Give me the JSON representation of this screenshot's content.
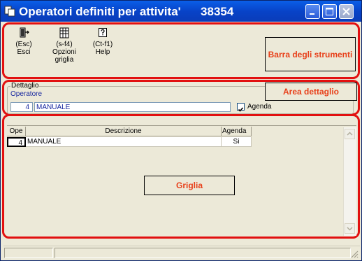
{
  "window": {
    "title": "Operatori definiti per attivita'",
    "record_number": "38354"
  },
  "toolbar": {
    "items": [
      {
        "key": "(Esc)",
        "label": "Esci",
        "icon": "exit-door-icon"
      },
      {
        "key": "(s-f4)",
        "label": "Opzioni griglia",
        "icon": "grid-options-icon"
      },
      {
        "key": "(Ct-f1)",
        "label": "Help",
        "icon": "help-icon"
      }
    ]
  },
  "annotations": {
    "toolbar": "Barra degli strumenti",
    "detail": "Area dettaglio",
    "grid": "Griglia"
  },
  "detail": {
    "group_label": "Dettaglio",
    "operator_label": "Operatore",
    "operator_code": "4",
    "operator_name": "MANUALE",
    "agenda_label": "Agenda",
    "agenda_checked": true
  },
  "grid": {
    "columns": [
      "Ope",
      "Descrizione",
      "Agenda"
    ],
    "rows": [
      {
        "code": "4",
        "description": "MANUALE",
        "agenda": "Si"
      }
    ]
  },
  "colors": {
    "annotation_border": "#e21010",
    "annotation_text": "#e8401a",
    "title_bar": "#0843c8"
  }
}
